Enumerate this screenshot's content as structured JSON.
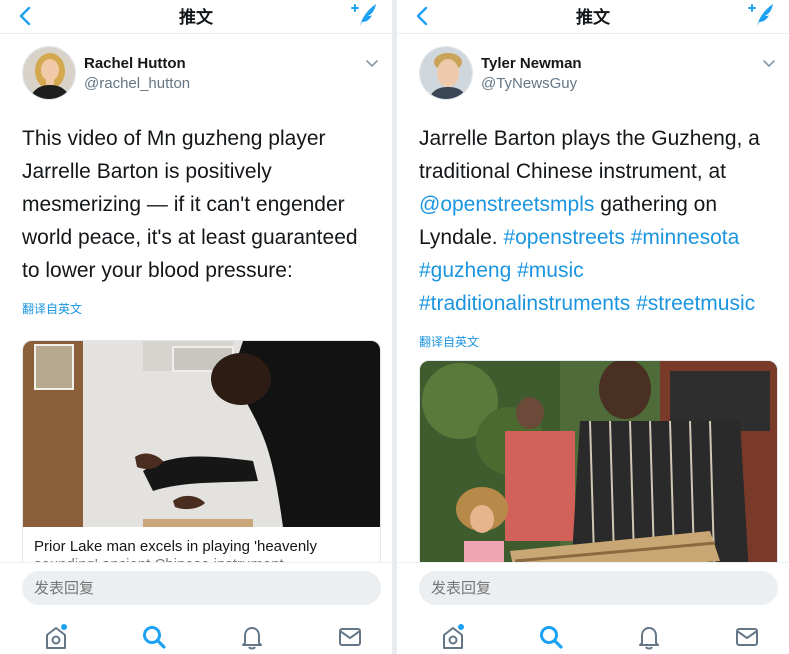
{
  "header": {
    "title": "推文"
  },
  "colors": {
    "accent": "#1da1f2",
    "link": "#1b95e0",
    "text": "#14171a",
    "secondary": "#657786",
    "input_bg": "#eceff1"
  },
  "icons": [
    "back-chevron-icon",
    "compose-feather-icon",
    "caret-down-icon",
    "home-icon",
    "search-icon",
    "bell-icon",
    "mail-icon"
  ],
  "left_tweet": {
    "author_name": "Rachel Hutton",
    "author_handle": "@rachel_hutton",
    "text_lines": [
      "This video of Mn guzheng player",
      "Jarrelle Barton is positively",
      "mesmerizing — if it can't engender",
      "world peace, it's at least guaranteed",
      "to lower your blood pressure:"
    ],
    "translate_label": "翻译自英文",
    "card_title": "Prior Lake man excels in playing 'heavenly",
    "card_subtitle": "sounding' ancient Chinese instrument"
  },
  "right_tweet": {
    "author_name": "Tyler Newman",
    "author_handle": "@TyNewsGuy",
    "text_line1": "Jarrelle Barton plays the Guzheng, a",
    "text_line2": "traditional Chinese instrument, at",
    "text_line3_link": "@openstreetsmpls",
    "text_line3_rest": " gathering on",
    "text_line4_plain": "Lyndale. ",
    "text_line4_tags": "#openstreets #minnesota",
    "text_line5_tags": "#guzheng #music",
    "text_line6_tags": "#traditionalinstruments #streetmusic",
    "translate_label": "翻译自英文"
  },
  "reply": {
    "placeholder": "发表回复"
  }
}
